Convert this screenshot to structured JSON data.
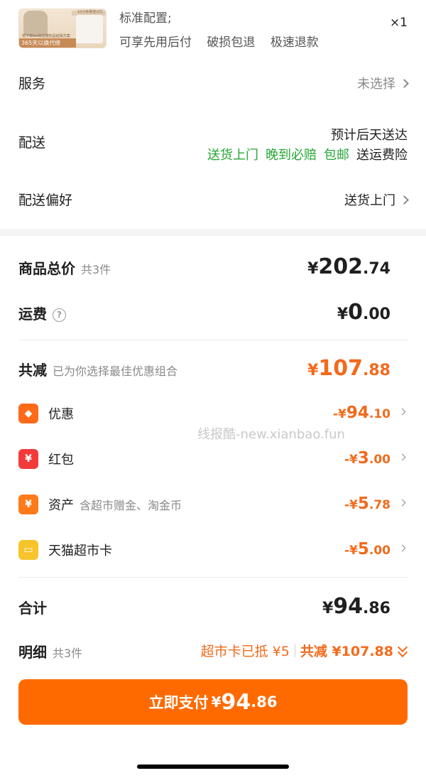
{
  "product": {
    "thumb_ribbon": "365天以换代修",
    "thumb_tag": "10分钟量壶记忆",
    "thumb_fine": "领下单tbs标注赠奶品延保方案",
    "line1": "标准配置;",
    "line2_parts": [
      "可享先用后付",
      "破损包退",
      "极速退款"
    ],
    "quantity": "×1"
  },
  "service": {
    "label": "服务",
    "value": "未选择"
  },
  "delivery": {
    "label": "配送",
    "estimate": "预计后天送达",
    "tags_green": [
      "送货上门",
      "晚到必赔",
      "包邮"
    ],
    "tag_plain": "送运费险"
  },
  "delivery_pref": {
    "label": "配送偏好",
    "value": "送货上门"
  },
  "summary": {
    "goods_total_label": "商品总价",
    "goods_count": "共3件",
    "goods_total": {
      "symbol": "¥",
      "int": "202",
      "dec": ".74"
    },
    "shipping_label": "运费",
    "help_icon_glyph": "?",
    "shipping": {
      "symbol": "¥",
      "int": "0",
      "dec": ".00"
    },
    "reduce_label": "共减",
    "reduce_note": "已为你选择最佳优惠组合",
    "reduce_total": {
      "symbol": "¥",
      "int": "107",
      "dec": ".88"
    }
  },
  "discounts": [
    {
      "label": "优惠",
      "sub": "",
      "icon": "coupon-tag-icon",
      "glyph": "◆",
      "color": "#ff6a1a",
      "amount": {
        "symbol": "-¥",
        "int": "94",
        "dec": ".10"
      }
    },
    {
      "label": "红包",
      "sub": "",
      "icon": "red-packet-icon",
      "glyph": "¥",
      "color": "#f23a3a",
      "amount": {
        "symbol": "-¥",
        "int": "3",
        "dec": ".00"
      }
    },
    {
      "label": "资产",
      "sub": "含超市赠金、淘金币",
      "icon": "assets-yen-icon",
      "glyph": "¥",
      "color": "#ff7a1a",
      "amount": {
        "symbol": "-¥",
        "int": "5",
        "dec": ".78"
      }
    },
    {
      "label": "天猫超市卡",
      "sub": "",
      "icon": "supermarket-card-icon",
      "glyph": "▭",
      "color": "#f7c42c",
      "amount": {
        "symbol": "-¥",
        "int": "5",
        "dec": ".00"
      }
    }
  ],
  "watermark": "线报酷-new.xianbao.fun",
  "total": {
    "label": "合计",
    "symbol": "¥",
    "int": "94",
    "dec": ".86"
  },
  "detail": {
    "label": "明细",
    "count": "共3件",
    "card_used": "超市卡已抵 ¥5",
    "reduce": "共减 ¥107.88"
  },
  "pay": {
    "label": "立即支付",
    "symbol": "¥",
    "int": "94",
    "dec": ".86"
  },
  "colors": {
    "accent": "#ff6a00",
    "green": "#25a634",
    "price_orange": "#f26a1b"
  }
}
